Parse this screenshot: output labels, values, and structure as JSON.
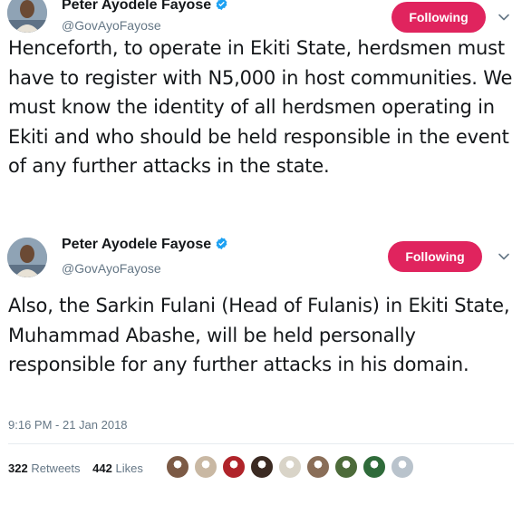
{
  "tweets": [
    {
      "author": {
        "name": "Peter Ayodele Fayose",
        "handle": "@GovAyoFayose",
        "verified": true
      },
      "follow_button_label": "Following",
      "text": "Henceforth, to operate in Ekiti State, herdsmen must have to register with N5,000 in host communities. We must know the identity of all herdsmen operating in Ekiti and who should be held responsible in the event of any further attacks in the state."
    },
    {
      "author": {
        "name": "Peter Ayodele Fayose",
        "handle": "@GovAyoFayose",
        "verified": true
      },
      "follow_button_label": "Following",
      "text": "Also,  the Sarkin Fulani (Head of Fulanis) in Ekiti State, Muhammad Abashe, will be held personally responsible for any further attacks in his domain.",
      "timestamp": "9:16 PM - 21 Jan 2018",
      "stats": {
        "retweets_count": "322",
        "retweets_label": "Retweets",
        "likes_count": "442",
        "likes_label": "Likes"
      },
      "liker_avatars": [
        "#7c5a45",
        "#c9b8a3",
        "#b0242a",
        "#3b2a22",
        "#d9d4c8",
        "#8a6e58",
        "#4d6b3a",
        "#2f6b3a",
        "#b9c3cc"
      ]
    }
  ],
  "colors": {
    "follow_button": "#e0245e",
    "verified_badge": "#1da1f2",
    "secondary_text": "#657786"
  },
  "icons": [
    "verified-badge-icon",
    "chevron-down-icon"
  ]
}
